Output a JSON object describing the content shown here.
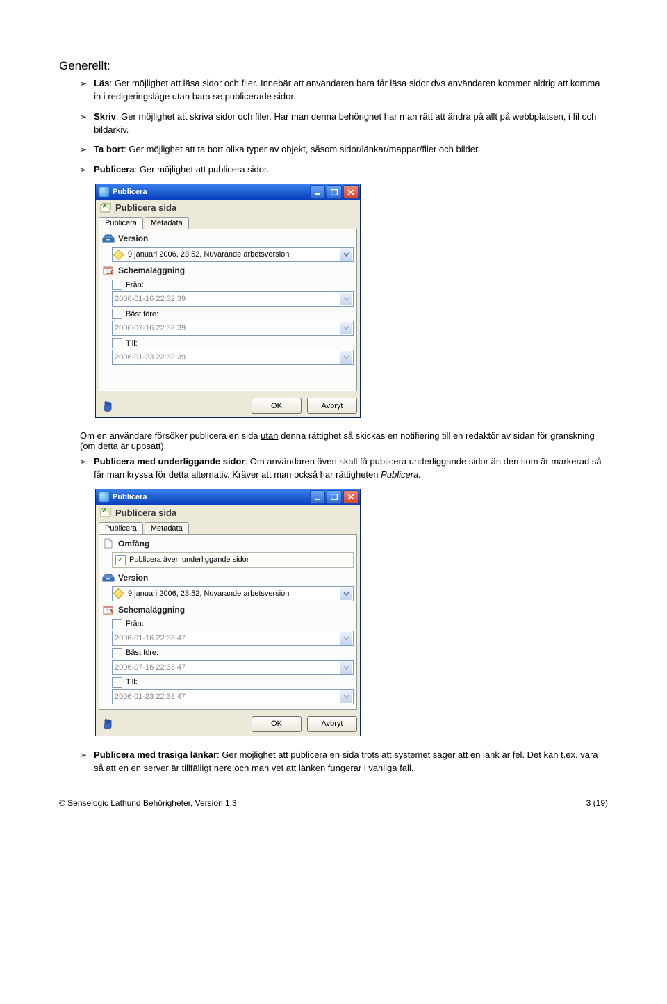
{
  "heading": "Generellt:",
  "bullets": [
    {
      "label": "Läs",
      "text": ": Ger möjlighet att läsa sidor och filer. Innebär att användaren bara får läsa sidor dvs användaren kommer aldrig att komma in i redigeringsläge utan bara se publicerade sidor."
    },
    {
      "label": "Skriv",
      "text": ": Ger möjlighet att skriva sidor och filer. Har man denna behörighet har man rätt att ändra på allt på webbplatsen, i fil och bildarkiv."
    },
    {
      "label": "Ta bort",
      "text": ": Ger möjlighet att ta bort olika typer av objekt, såsom sidor/länkar/mappar/filer och bilder."
    },
    {
      "label": "Publicera",
      "text": ": Ger möjlighet att publicera sidor."
    }
  ],
  "dialog1": {
    "title": "Publicera",
    "crumb": "Publicera sida",
    "tabs": [
      "Publicera",
      "Metadata"
    ],
    "version_label": "Version",
    "version_value": "9 januari 2006, 23:52, Nuvarande arbetsversion",
    "schedule_label": "Schemaläggning",
    "fran_label": "Från:",
    "fran_value": "2006-01-16 22:32:39",
    "bast_label": "Bäst före:",
    "bast_value": "2006-07-16 22:32:39",
    "till_label": "Till:",
    "till_value": "2006-01-23 22:32:39",
    "ok": "OK",
    "cancel": "Avbryt"
  },
  "middle_para": "Om en användare försöker publicera en sida ",
  "middle_u": "utan",
  "middle_para2": " denna rättighet så skickas en notifiering till en redaktör av sidan för granskning (om detta är uppsatt).",
  "bullet5_label": "Publicera  med underliggande sidor",
  "bullet5_text": ":  Om användaren även skall få publicera underliggande sidor än den som är markerad så får man kryssa för detta alternativ. Kräver att man också har rättigheten ",
  "bullet5_em": "Publicera.",
  "dialog2": {
    "title": "Publicera",
    "crumb": "Publicera sida",
    "tabs": [
      "Publicera",
      "Metadata"
    ],
    "omfang_label": "Omfång",
    "omfang_check": "Publicera även underliggande sidor",
    "version_label": "Version",
    "version_value": "9 januari 2006, 23:52, Nuvarande arbetsversion",
    "schedule_label": "Schemaläggning",
    "fran_label": "Från:",
    "fran_value": "2006-01-16 22:33:47",
    "bast_label": "Bäst före:",
    "bast_value": "2006-07-16 22:33:47",
    "till_label": "Till:",
    "till_value": "2006-01-23 22:33:47",
    "ok": "OK",
    "cancel": "Avbryt"
  },
  "bullet6_label": "Publicera med trasiga länkar",
  "bullet6_text": ": Ger möjlighet att publicera en sida trots att systemet säger att en länk är fel. Det kan t.ex. vara så att en en server är tillfälligt nere och man vet att länken fungerar i vanliga fall.",
  "footer_left": "© Senselogic Lathund Behörigheter, Version 1.3",
  "footer_right": "3 (19)"
}
